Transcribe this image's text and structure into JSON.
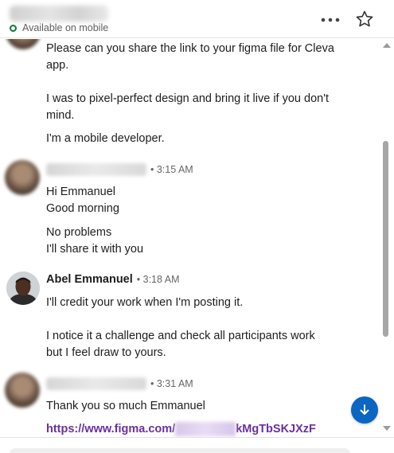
{
  "header": {
    "status": "Available on mobile",
    "status_color": "#0a7a2f",
    "more_icon": "more-horizontal-icon",
    "star_icon": "star-icon"
  },
  "messages": [
    {
      "paragraphs": [
        "Please can you share the link to your figma file for Cleva app.",
        "I was to pixel-perfect design and bring it live if you don't mind.",
        "I'm a mobile developer."
      ]
    },
    {
      "time": "• 3:15 AM",
      "paragraphs": [
        "Hi Emmanuel",
        "Good morning",
        "No problems",
        "I'll share it with you"
      ]
    },
    {
      "author": "Abel Emmanuel",
      "time": "• 3:18 AM",
      "paragraphs": [
        "I'll credit your work when I'm posting it.",
        "I notice it a challenge and check all participants work but I feel draw to yours."
      ]
    },
    {
      "time": "• 3:31 AM",
      "paragraphs": [
        "Thank you so much Emmanuel"
      ],
      "link_start": "https://www.figma.com/",
      "link_end": "kMgTbSKJXzF",
      "link_color": "#6a2fa0"
    }
  ],
  "jump_button": {
    "icon": "arrow-down-icon",
    "color": "#0a66c2"
  }
}
